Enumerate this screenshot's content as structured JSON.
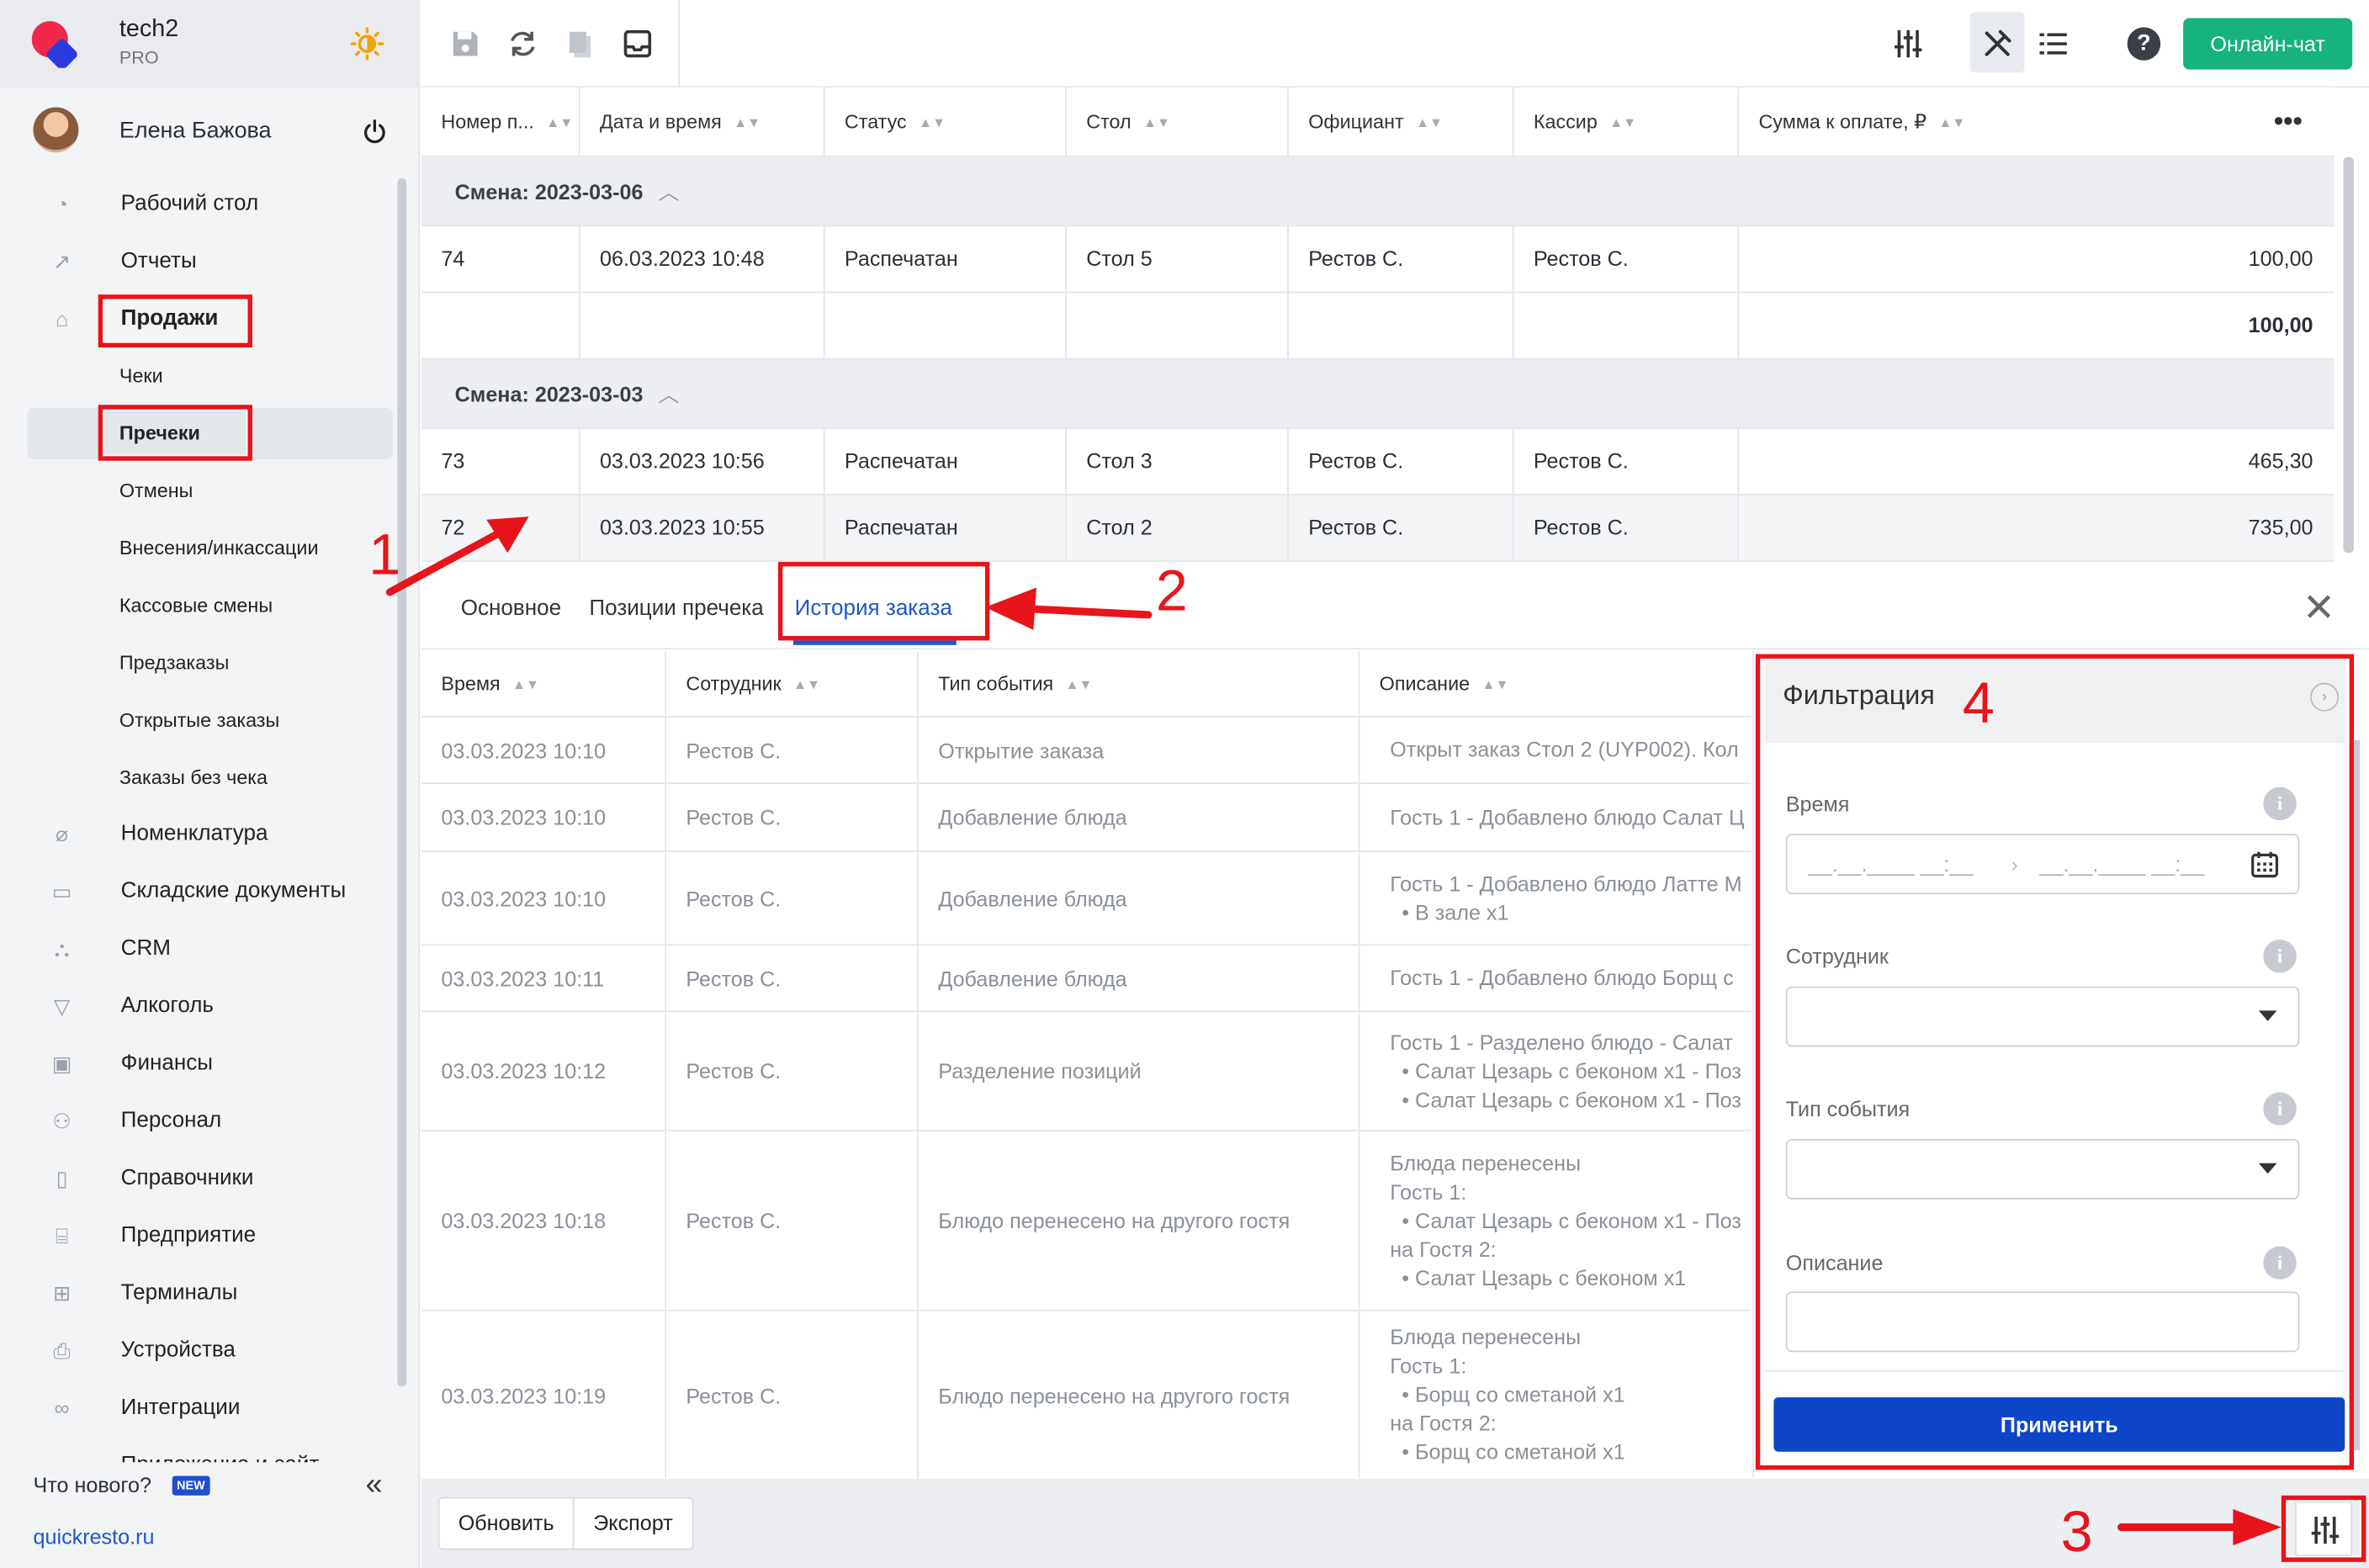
{
  "brand": {
    "name": "tech2",
    "plan": "PRO"
  },
  "user": {
    "name": "Елена Бажова"
  },
  "sidebar": {
    "items": [
      {
        "label": "Рабочий стол",
        "icon": "dashboard-icon"
      },
      {
        "label": "Отчеты",
        "icon": "chart-icon"
      },
      {
        "label": "Продажи",
        "icon": "basket-icon"
      },
      {
        "label": "Номенклатура",
        "icon": "tag-icon"
      },
      {
        "label": "Складские документы",
        "icon": "box-icon"
      },
      {
        "label": "CRM",
        "icon": "crm-icon"
      },
      {
        "label": "Алкоголь",
        "icon": "glass-icon"
      },
      {
        "label": "Финансы",
        "icon": "wallet-icon"
      },
      {
        "label": "Персонал",
        "icon": "people-icon"
      },
      {
        "label": "Справочники",
        "icon": "book-icon"
      },
      {
        "label": "Предприятие",
        "icon": "store-icon"
      },
      {
        "label": "Терминалы",
        "icon": "qr-icon"
      },
      {
        "label": "Устройства",
        "icon": "printer-icon"
      },
      {
        "label": "Интеграции",
        "icon": "link-icon"
      },
      {
        "label": "Приложение и сайт",
        "icon": "app-icon"
      }
    ],
    "sales_sub": [
      "Чеки",
      "Пречеки",
      "Отмены",
      "Внесения/инкассации",
      "Кассовые смены",
      "Предзаказы",
      "Открытые заказы",
      "Заказы без чека"
    ],
    "whats_new": "Что нового?",
    "new_badge": "NEW",
    "site": "quickresto.ru"
  },
  "toolbar": {
    "chat_label": "Онлайн-чат",
    "help": "?"
  },
  "table": {
    "columns": [
      "Номер п...",
      "Дата и время",
      "Статус",
      "Стол",
      "Официант",
      "Кассир",
      "Сумма к оплате, ₽"
    ],
    "groups": [
      {
        "shift": "Смена: 2023-03-06",
        "rows": [
          {
            "num": "74",
            "dt": "06.03.2023 10:48",
            "status": "Распечатан",
            "table": "Стол 5",
            "waiter": "Рестов С.",
            "cashier": "Рестов С.",
            "sum": "100,00"
          }
        ],
        "total": "100,00"
      },
      {
        "shift": "Смена: 2023-03-03",
        "rows": [
          {
            "num": "73",
            "dt": "03.03.2023 10:56",
            "status": "Распечатан",
            "table": "Стол 3",
            "waiter": "Рестов С.",
            "cashier": "Рестов С.",
            "sum": "465,30"
          },
          {
            "num": "72",
            "dt": "03.03.2023 10:55",
            "status": "Распечатан",
            "table": "Стол 2",
            "waiter": "Рестов С.",
            "cashier": "Рестов С.",
            "sum": "735,00"
          }
        ]
      }
    ]
  },
  "detail": {
    "tabs": [
      "Основное",
      "Позиции пречека",
      "История заказа"
    ],
    "columns": [
      "Время",
      "Сотрудник",
      "Тип события",
      "Описание"
    ],
    "rows": [
      {
        "time": "03.03.2023 10:10",
        "emp": "Рестов С.",
        "type": "Открытие заказа",
        "desc": [
          "Открыт заказ Стол 2 (UYP002). Кол"
        ]
      },
      {
        "time": "03.03.2023 10:10",
        "emp": "Рестов С.",
        "type": "Добавление блюда",
        "desc": [
          "Гость 1 - Добавлено блюдо Салат Ц"
        ]
      },
      {
        "time": "03.03.2023 10:10",
        "emp": "Рестов С.",
        "type": "Добавление блюда",
        "desc": [
          "Гость 1 - Добавлено блюдо Латте М",
          "  • В зале x1"
        ]
      },
      {
        "time": "03.03.2023 10:11",
        "emp": "Рестов С.",
        "type": "Добавление блюда",
        "desc": [
          "Гость 1 - Добавлено блюдо Борщ с"
        ]
      },
      {
        "time": "03.03.2023 10:12",
        "emp": "Рестов С.",
        "type": "Разделение позиций",
        "desc": [
          "Гость 1 - Разделено блюдо - Салат",
          "  • Салат Цезарь с беконом x1 - Поз",
          "  • Салат Цезарь с беконом x1 - Поз"
        ]
      },
      {
        "time": "03.03.2023 10:18",
        "emp": "Рестов С.",
        "type": "Блюдо перенесено на другого гостя",
        "desc": [
          "Блюда перенесены",
          "Гость 1:",
          "  • Салат Цезарь с беконом x1 - Поз",
          "на Гостя 2:",
          "  • Салат Цезарь с беконом x1"
        ]
      },
      {
        "time": "03.03.2023 10:19",
        "emp": "Рестов С.",
        "type": "Блюдо перенесено на другого гостя",
        "desc": [
          "Блюда перенесены",
          "Гость 1:",
          "  • Борщ со сметаной x1",
          "на Гостя 2:",
          "  • Борщ со сметаной x1"
        ]
      }
    ]
  },
  "filter": {
    "title": "Фильтрация",
    "time_label": "Время",
    "date_placeholder": "__.__.____ __:__",
    "employee_label": "Сотрудник",
    "event_label": "Тип события",
    "desc_label": "Описание",
    "apply": "Применить"
  },
  "bottom": {
    "refresh": "Обновить",
    "export": "Экспорт"
  },
  "annotations": [
    "1",
    "2",
    "3",
    "4"
  ],
  "colors": {
    "accent": "#1d56c9",
    "chat": "#16b37c",
    "apply": "#0d47c7",
    "annotation": "#e8141b"
  }
}
